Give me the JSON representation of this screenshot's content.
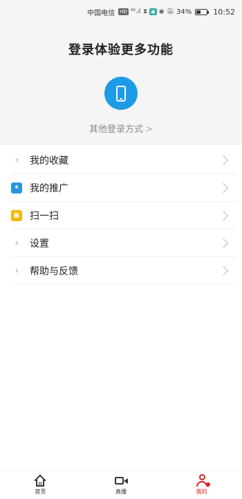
{
  "status_bar": {
    "carrier": "中国电信",
    "badge_hd": "HD",
    "signal": "⁴⁶.ıl",
    "battery_percent": "34%",
    "battery_level": 0.34,
    "time": "10:52"
  },
  "header": {
    "title": "登录体验更多功能",
    "other_login": "其他登录方式",
    "other_login_chevron": ">",
    "phone_icon": "phone-icon",
    "accent_color": "#1e9be5"
  },
  "menu": {
    "items": [
      {
        "label": "我的收藏",
        "icon": "favorites-icon",
        "icon_glyph": "з"
      },
      {
        "label": "我的推广",
        "icon": "promotion-icon",
        "icon_glyph": "✦"
      },
      {
        "label": "扫一扫",
        "icon": "scan-icon",
        "icon_glyph": "▣"
      },
      {
        "label": "设置",
        "icon": "settings-icon",
        "icon_glyph": "з"
      },
      {
        "label": "帮助与反馈",
        "icon": "help-icon",
        "icon_glyph": "з"
      }
    ]
  },
  "bottom_nav": {
    "items": [
      {
        "label": "首页",
        "icon": "home-icon"
      },
      {
        "label": "直播",
        "icon": "video-icon"
      },
      {
        "label": "我的",
        "icon": "user-icon",
        "active": true
      }
    ],
    "active_color": "#d81e1e"
  }
}
